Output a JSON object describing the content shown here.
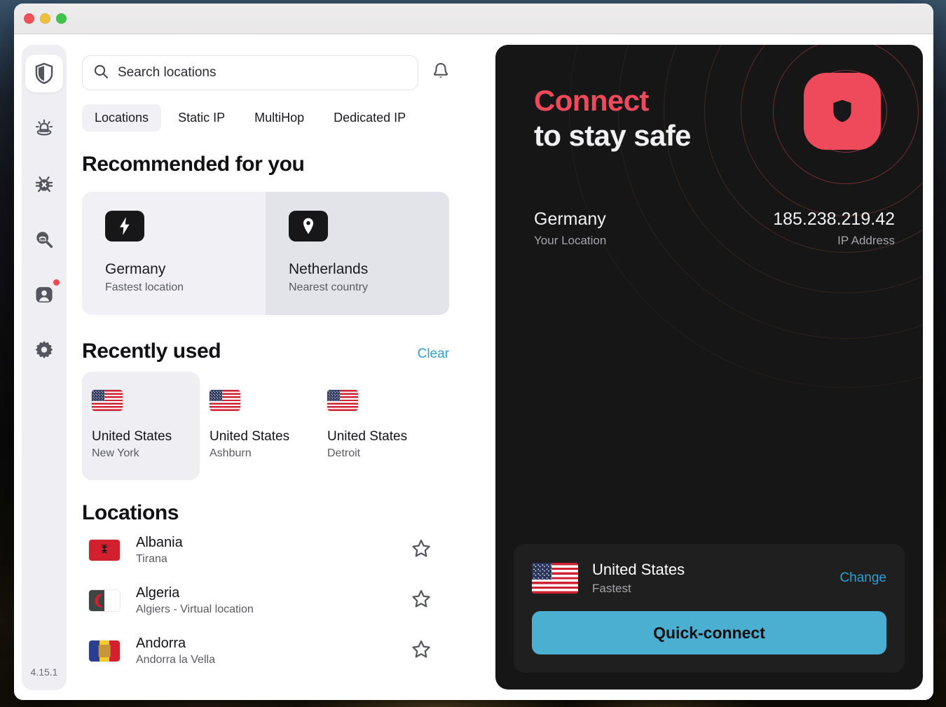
{
  "window": {
    "traffic_lights": [
      "close",
      "minimize",
      "zoom"
    ]
  },
  "sidebar": {
    "version": "4.15.1",
    "items": [
      {
        "name": "vpn",
        "icon": "shield-icon",
        "active": true,
        "badge": false
      },
      {
        "name": "threat-protection",
        "icon": "siren-icon",
        "active": false,
        "badge": false
      },
      {
        "name": "malware-scan",
        "icon": "bug-icon",
        "active": false,
        "badge": false
      },
      {
        "name": "dark-web-monitor",
        "icon": "search-eye-icon",
        "active": false,
        "badge": false
      },
      {
        "name": "account",
        "icon": "user-profile-icon",
        "active": false,
        "badge": true
      },
      {
        "name": "settings",
        "icon": "gear-icon",
        "active": false,
        "badge": false
      }
    ]
  },
  "search": {
    "placeholder": "Search locations",
    "value": "",
    "icon": "search-icon"
  },
  "notifications": {
    "icon": "bell-icon"
  },
  "tabs": [
    {
      "label": "Locations",
      "active": true
    },
    {
      "label": "Static IP",
      "active": false
    },
    {
      "label": "MultiHop",
      "active": false
    },
    {
      "label": "Dedicated IP",
      "active": false
    }
  ],
  "recommended": {
    "title": "Recommended for you",
    "cards": [
      {
        "icon": "lightning-bolt-icon",
        "name": "Germany",
        "sub": "Fastest location",
        "hovered": false
      },
      {
        "icon": "map-pin-icon",
        "name": "Netherlands",
        "sub": "Nearest country",
        "hovered": true
      }
    ]
  },
  "recently_used": {
    "title": "Recently used",
    "clear_label": "Clear",
    "cards": [
      {
        "flag": "us",
        "name": "United States",
        "sub": "New York",
        "hovered": true
      },
      {
        "flag": "us",
        "name": "United States",
        "sub": "Ashburn",
        "hovered": false
      },
      {
        "flag": "us",
        "name": "United States",
        "sub": "Detroit",
        "hovered": false
      }
    ]
  },
  "locations": {
    "title": "Locations",
    "rows": [
      {
        "flag": "al",
        "name": "Albania",
        "sub": "Tirana",
        "favorite": false
      },
      {
        "flag": "dz",
        "name": "Algeria",
        "sub": "Algiers - Virtual location",
        "favorite": false
      },
      {
        "flag": "ad",
        "name": "Andorra",
        "sub": "Andorra la Vella",
        "favorite": false
      }
    ]
  },
  "hero": {
    "headline_accent": "Connect",
    "headline_rest": "to stay safe",
    "location_value": "Germany",
    "location_label": "Your Location",
    "ip_value": "185.238.219.42",
    "ip_label": "IP Address",
    "badge_icon": "shield-badge-icon"
  },
  "quick_connect": {
    "flag": "us",
    "name": "United States",
    "sub": "Fastest",
    "change_label": "Change",
    "button_label": "Quick-connect"
  },
  "colors": {
    "accent_red": "#ef4a5c",
    "link_blue": "#2f9fd0",
    "button_blue": "#4bafd2",
    "hero_bg": "#161616",
    "panel_bg": "#1f1f1f"
  }
}
